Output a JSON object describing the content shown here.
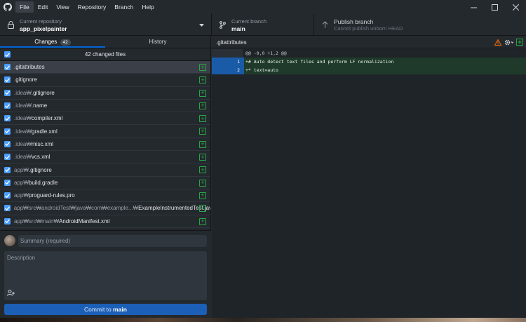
{
  "menu": {
    "items": [
      "File",
      "Edit",
      "View",
      "Repository",
      "Branch",
      "Help"
    ],
    "active": "File"
  },
  "toolbar": {
    "repo_label": "Current repository",
    "repo_value": "app_pixelpainter",
    "branch_label": "Current branch",
    "branch_value": "main",
    "publish_label": "Publish branch",
    "publish_sub": "Cannot publish unborn HEAD"
  },
  "tabs": {
    "changes": "Changes",
    "changes_count": "42",
    "history": "History"
  },
  "file_list": {
    "header": "42 changed files",
    "files": [
      {
        "dir": "",
        "name": ".gitattributes"
      },
      {
        "dir": "",
        "name": ".gitignore"
      },
      {
        "dir": ".idea₩",
        "name": ".gitignore"
      },
      {
        "dir": ".idea₩",
        "name": ".name"
      },
      {
        "dir": ".idea₩",
        "name": "compiler.xml"
      },
      {
        "dir": ".idea₩",
        "name": "gradle.xml"
      },
      {
        "dir": ".idea₩",
        "name": "misc.xml"
      },
      {
        "dir": ".idea₩",
        "name": "vcs.xml"
      },
      {
        "dir": "app₩",
        "name": ".gitignore"
      },
      {
        "dir": "app₩",
        "name": "build.gradle"
      },
      {
        "dir": "app₩",
        "name": "proguard-rules.pro"
      },
      {
        "dir": "app₩src₩androidTest₩java₩com₩example...₩",
        "name": "ExampleInstrumentedTest.java"
      },
      {
        "dir": "app₩src₩main₩",
        "name": "AndroidManifest.xml"
      }
    ]
  },
  "commit": {
    "summary_placeholder": "Summary (required)",
    "description_placeholder": "Description",
    "button_prefix": "Commit to ",
    "button_branch": "main"
  },
  "diff": {
    "file": ".gitattributes",
    "hunk": "@@ -0,0 +1,2 @@",
    "lines": [
      {
        "new": "1",
        "text": "+# Auto detect text files and perform LF normalization"
      },
      {
        "new": "2",
        "text": "+* text=auto"
      }
    ]
  },
  "colors": {
    "accent": "#0366d6",
    "added": "#28a745",
    "warning": "#f66a0a"
  }
}
